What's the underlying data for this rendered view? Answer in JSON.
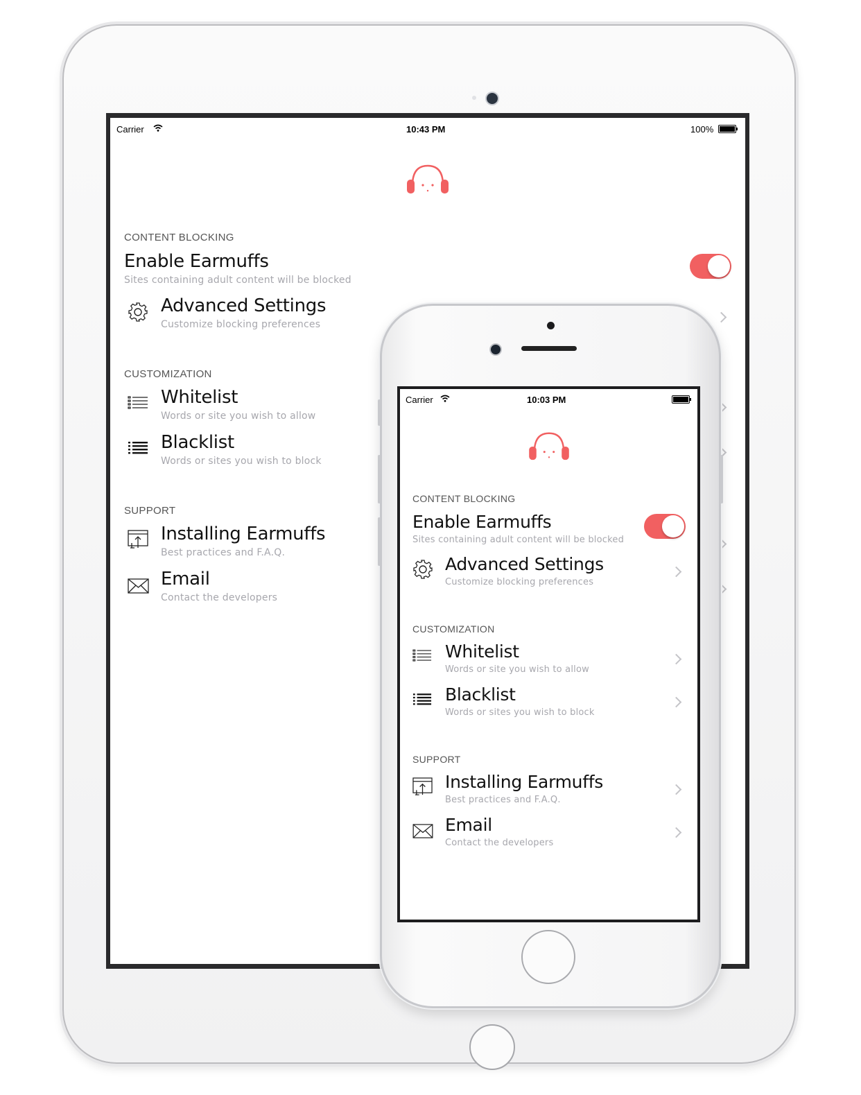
{
  "accent_color": "#f16061",
  "ipad": {
    "status": {
      "carrier": "Carrier",
      "time": "10:43 PM",
      "battery": "100%"
    },
    "logo_icon": "headphones-face-icon",
    "sections": {
      "content_blocking": "CONTENT BLOCKING",
      "customization": "CUSTOMIZATION",
      "support": "SUPPORT"
    },
    "rows": {
      "enable": {
        "title": "Enable Earmuffs",
        "subtitle": "Sites containing adult content will be blocked",
        "toggle_on": true
      },
      "advanced": {
        "title": "Advanced Settings",
        "subtitle": "Customize blocking preferences",
        "icon": "gear-icon"
      },
      "whitelist": {
        "title": "Whitelist",
        "subtitle": "Words or site you wish to allow",
        "icon": "list-outline-icon"
      },
      "blacklist": {
        "title": "Blacklist",
        "subtitle": "Words or sites you wish to block",
        "icon": "list-filled-icon"
      },
      "installing": {
        "title": "Installing Earmuffs",
        "subtitle": "Best practices and F.A.Q.",
        "icon": "install-window-icon"
      },
      "email": {
        "title": "Email",
        "subtitle": "Contact the developers",
        "icon": "envelope-icon"
      }
    }
  },
  "iphone": {
    "status": {
      "carrier": "Carrier",
      "time": "10:03 PM"
    },
    "logo_icon": "headphones-face-icon",
    "sections": {
      "content_blocking": "CONTENT BLOCKING",
      "customization": "CUSTOMIZATION",
      "support": "SUPPORT"
    },
    "rows": {
      "enable": {
        "title": "Enable Earmuffs",
        "subtitle": "Sites containing adult content will be blocked",
        "toggle_on": true
      },
      "advanced": {
        "title": "Advanced Settings",
        "subtitle": "Customize blocking preferences",
        "icon": "gear-icon"
      },
      "whitelist": {
        "title": "Whitelist",
        "subtitle": "Words or site you wish to allow",
        "icon": "list-outline-icon"
      },
      "blacklist": {
        "title": "Blacklist",
        "subtitle": "Words or sites you wish to block",
        "icon": "list-filled-icon"
      },
      "installing": {
        "title": "Installing Earmuffs",
        "subtitle": "Best practices and F.A.Q.",
        "icon": "install-window-icon"
      },
      "email": {
        "title": "Email",
        "subtitle": "Contact the developers",
        "icon": "envelope-icon"
      }
    }
  }
}
